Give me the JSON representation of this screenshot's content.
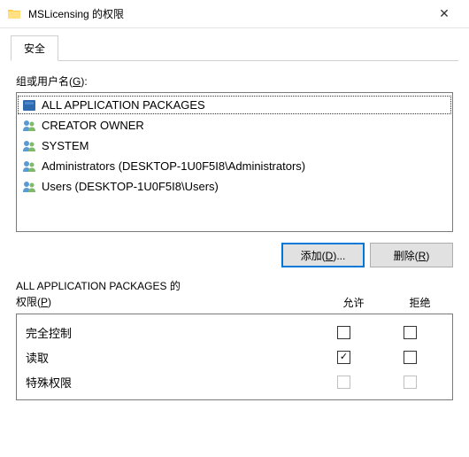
{
  "window": {
    "title": "MSLicensing 的权限"
  },
  "tabs": {
    "security": "安全"
  },
  "labels": {
    "group_or_user": "组或用户名(",
    "group_or_user_key": "G",
    "group_or_user_suffix": "):"
  },
  "principals": [
    {
      "name": "ALL APPLICATION PACKAGES",
      "icon": "package",
      "selected": true
    },
    {
      "name": "CREATOR OWNER",
      "icon": "users",
      "selected": false
    },
    {
      "name": "SYSTEM",
      "icon": "users",
      "selected": false
    },
    {
      "name": "Administrators (DESKTOP-1U0F5I8\\Administrators)",
      "icon": "users",
      "selected": false
    },
    {
      "name": "Users (DESKTOP-1U0F5I8\\Users)",
      "icon": "users",
      "selected": false
    }
  ],
  "buttons": {
    "add_prefix": "添加(",
    "add_key": "D",
    "add_suffix": ")...",
    "remove_prefix": "删除(",
    "remove_key": "R",
    "remove_suffix": ")"
  },
  "perm_header": {
    "title_prefix": "ALL APPLICATION PACKAGES 的",
    "title_line2a": "权限(",
    "title_key": "P",
    "title_line2b": ")",
    "allow": "允许",
    "deny": "拒绝"
  },
  "permissions": [
    {
      "name": "完全控制",
      "allow": false,
      "deny": false,
      "disabled": false
    },
    {
      "name": "读取",
      "allow": true,
      "deny": false,
      "disabled": false
    },
    {
      "name": "特殊权限",
      "allow": false,
      "deny": false,
      "disabled": true
    }
  ]
}
